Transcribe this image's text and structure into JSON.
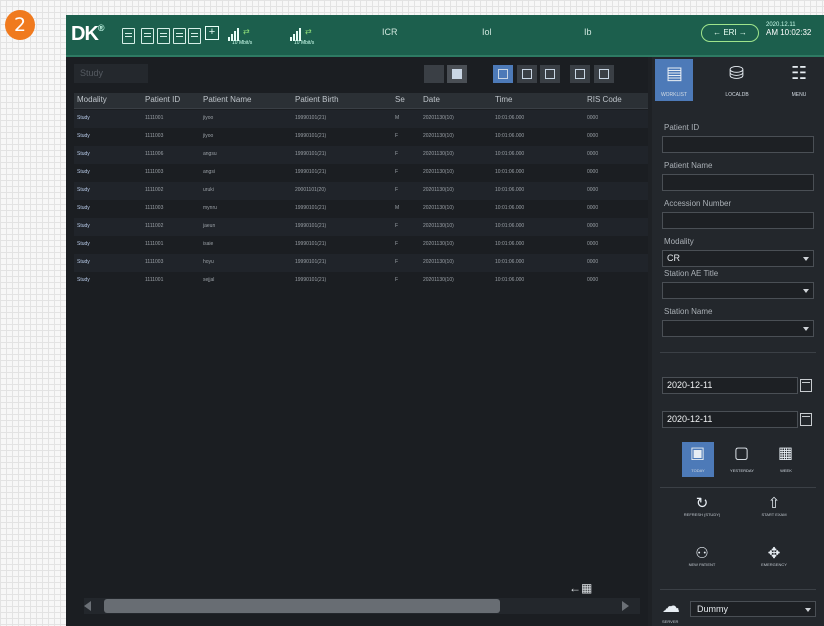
{
  "step_badge": "2",
  "topbar": {
    "logo": "DK",
    "logo_sup": "®",
    "wifi1_label": "10 Mbit/s",
    "wifi2_label": "10 Mbit/s",
    "item1": "ICR",
    "item2": "Iol",
    "item3": "Ib",
    "pill": "← ERI →",
    "clock_line1": "2020.12.11",
    "clock_line2": "AM 10:02:32",
    "accent": "#1c5f4d"
  },
  "main": {
    "study_label": "Study",
    "columns": [
      "Modality",
      "Patient ID",
      "Patient Name",
      "Patient Birth",
      "Se",
      "Date",
      "Time",
      "RIS Code"
    ],
    "rows": [
      [
        "Study",
        "1111001",
        "jiyoo",
        "19990101(21)",
        "M",
        "20201130(10)",
        "10:01:06.000",
        "0000"
      ],
      [
        "Study",
        "1111003",
        "jiyoo",
        "19990101(21)",
        "F",
        "20201130(10)",
        "10:01:06.000",
        "0000"
      ],
      [
        "Study",
        "1111006",
        "angsu",
        "19990101(21)",
        "F",
        "20201130(10)",
        "10:01:06.000",
        "0000"
      ],
      [
        "Study",
        "1111003",
        "angsi",
        "19990101(21)",
        "F",
        "20201130(10)",
        "10:01:06.000",
        "0000"
      ],
      [
        "Study",
        "1111002",
        "uruki",
        "20001101(20)",
        "F",
        "20201130(10)",
        "10:01:06.000",
        "0000"
      ],
      [
        "Study",
        "1111003",
        "mynru",
        "19990101(21)",
        "M",
        "20201130(10)",
        "10:01:06.000",
        "0000"
      ],
      [
        "Study",
        "1111002",
        "jaeun",
        "19990101(21)",
        "F",
        "20201130(10)",
        "10:01:06.000",
        "0000"
      ],
      [
        "Study",
        "1111001",
        "isaie",
        "19990101(21)",
        "F",
        "20201130(10)",
        "10:01:06.000",
        "0000"
      ],
      [
        "Study",
        "1111003",
        "hoyu",
        "19990101(21)",
        "F",
        "20201130(10)",
        "10:01:06.000",
        "0000"
      ],
      [
        "Study",
        "1111001",
        "sejjal",
        "19990101(21)",
        "F",
        "20201130(10)",
        "10:01:06.000",
        "0000"
      ]
    ]
  },
  "side": {
    "modes": [
      {
        "icon": "worklist-icon",
        "glyph": "▤",
        "label": "WORKLIST"
      },
      {
        "icon": "database-icon",
        "glyph": "⛁",
        "label": "LOCALDB"
      },
      {
        "icon": "menu-icon",
        "glyph": "☷",
        "label": "MENU"
      }
    ],
    "fields": {
      "patient_id_label": "Patient ID",
      "patient_id_value": "",
      "patient_name_label": "Patient Name",
      "patient_name_value": "",
      "accession_label": "Accession Number",
      "accession_value": "",
      "modality_label": "Modality",
      "modality_value": "CR",
      "station_ae_label": "Station AE Title",
      "station_ae_value": "",
      "station_name_label": "Station Name",
      "station_name_value": ""
    },
    "date_from": "2020-12-11",
    "date_to": "2020-12-11",
    "range_modes": [
      {
        "icon": "today-icon",
        "glyph": "▣",
        "label": "TODAY"
      },
      {
        "icon": "yesterday-icon",
        "glyph": "▢",
        "label": "YESTERDAY"
      },
      {
        "icon": "week-icon",
        "glyph": "▦",
        "label": "WEEK"
      }
    ],
    "actions": [
      {
        "icon": "refresh-icon",
        "glyph": "↻",
        "label": "REFRESH (STUDY)"
      },
      {
        "icon": "start-exam-icon",
        "glyph": "⇧",
        "label": "START EXAM"
      },
      {
        "icon": "new-patient-icon",
        "glyph": "⚇",
        "label": "NEW PATIENT"
      },
      {
        "icon": "emergency-icon",
        "glyph": "✥",
        "label": "EMERGENCY"
      }
    ],
    "sync_label": "SERVER",
    "sync_value": "Dummy"
  }
}
